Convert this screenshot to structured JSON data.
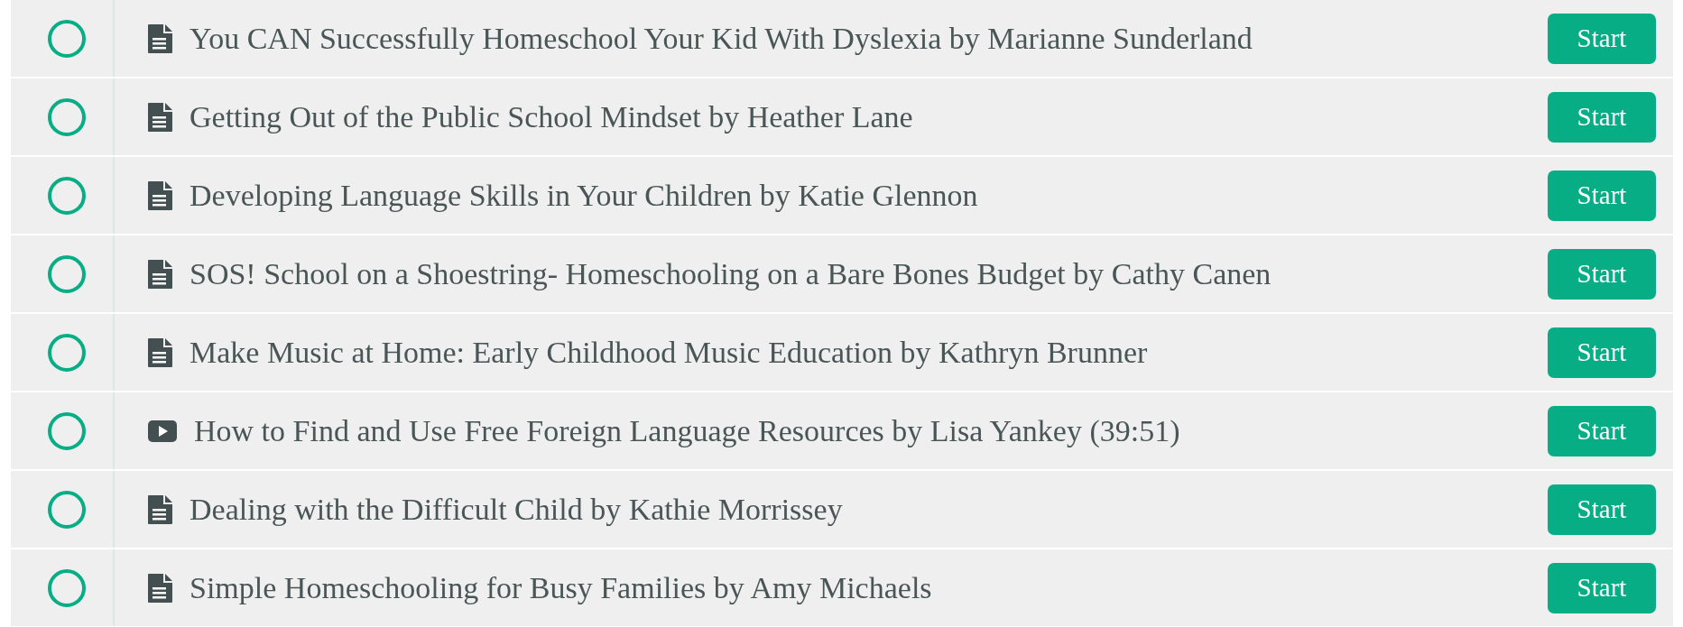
{
  "lessons": [
    {
      "kind": "document",
      "title": "You CAN Successfully Homeschool Your Kid With Dyslexia by Marianne Sunderland",
      "completed": false,
      "button": "Start"
    },
    {
      "kind": "document",
      "title": "Getting Out of the Public School Mindset by Heather Lane",
      "completed": false,
      "button": "Start"
    },
    {
      "kind": "document",
      "title": "Developing Language Skills in Your Children by Katie Glennon",
      "completed": false,
      "button": "Start"
    },
    {
      "kind": "document",
      "title": "SOS! School on a Shoestring- Homeschooling on a Bare Bones Budget by Cathy Canen",
      "completed": false,
      "button": "Start"
    },
    {
      "kind": "document",
      "title": "Make Music at Home: Early Childhood Music Education by Kathryn Brunner",
      "completed": false,
      "button": "Start"
    },
    {
      "kind": "video",
      "title": "How to Find and Use Free Foreign Language Resources by Lisa Yankey (39:51)",
      "completed": false,
      "button": "Start"
    },
    {
      "kind": "document",
      "title": "Dealing with the Difficult Child by Kathie Morrissey",
      "completed": false,
      "button": "Start"
    },
    {
      "kind": "document",
      "title": "Simple Homeschooling for Busy Families by Amy Michaels",
      "completed": false,
      "button": "Start"
    }
  ]
}
